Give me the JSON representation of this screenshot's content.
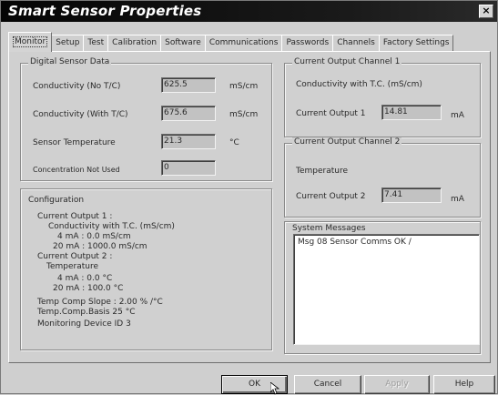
{
  "window": {
    "title": "Smart Sensor Properties",
    "close_glyph": "×"
  },
  "tabs": [
    {
      "label": "Monitor",
      "active": true
    },
    {
      "label": "Setup"
    },
    {
      "label": "Test"
    },
    {
      "label": "Calibration"
    },
    {
      "label": "Software"
    },
    {
      "label": "Communications"
    },
    {
      "label": "Passwords"
    },
    {
      "label": "Channels"
    },
    {
      "label": "Factory Settings"
    }
  ],
  "digital_sensor_data": {
    "title": "Digital Sensor Data",
    "rows": [
      {
        "label": "Conductivity  (No T/C)",
        "value": "625.5",
        "unit": "mS/cm"
      },
      {
        "label": "Conductivity (With T/C)",
        "value": "675.6",
        "unit": "mS/cm"
      },
      {
        "label": "Sensor Temperature",
        "value": "21.3",
        "unit": "°C"
      },
      {
        "label": "Concentration Not Used",
        "value": "0",
        "unit": ""
      }
    ]
  },
  "configuration": {
    "title": "Configuration",
    "lines": [
      "Current Output 1 :",
      "Conductivity with T.C. (mS/cm)",
      "4 mA : 0.0 mS/cm",
      "20 mA : 1000.0 mS/cm",
      "Current Output 2 :",
      "Temperature",
      "4 mA : 0.0 °C",
      "20 mA : 100.0 °C",
      "Temp Comp Slope : 2.00 % /°C",
      "Temp.Comp.Basis 25 °C",
      "Monitoring Device ID 3"
    ]
  },
  "channel1": {
    "title": "Current Output Channel 1",
    "subtitle": "Conductivity with T.C. (mS/cm)",
    "output_label": "Current Output 1",
    "value": "14.81",
    "unit": "mA"
  },
  "channel2": {
    "title": "Current Output Channel 2",
    "subtitle": "Temperature",
    "output_label": "Current Output 2",
    "value": "7.41",
    "unit": "mA"
  },
  "system_messages": {
    "title": "System Messages",
    "text": "Msg 08  Sensor Comms OK   /"
  },
  "buttons": {
    "ok": "OK",
    "cancel": "Cancel",
    "apply": "Apply",
    "help": "Help"
  }
}
